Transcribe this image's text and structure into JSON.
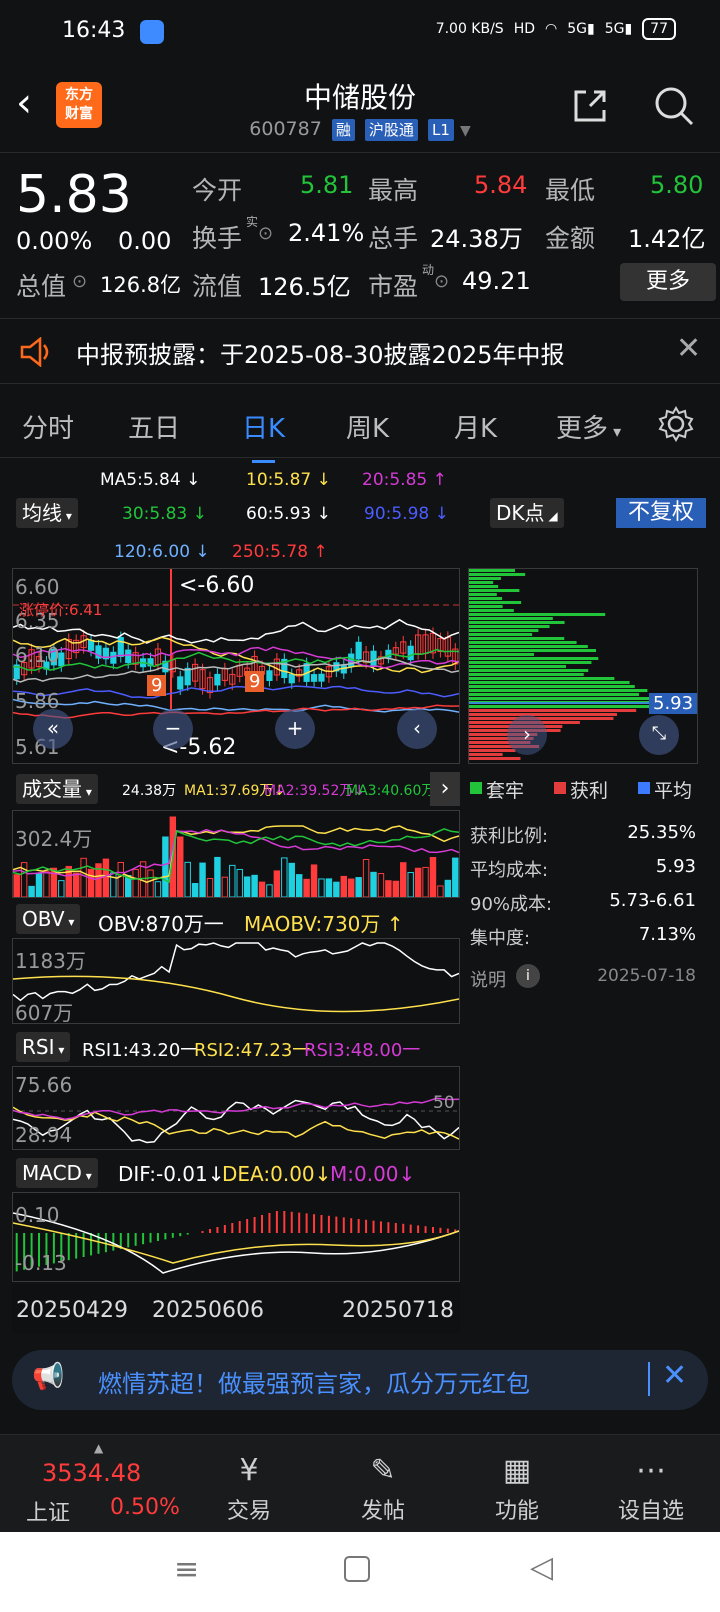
{
  "status": {
    "time": "16:43",
    "net_speed": "7.00 KB/S",
    "battery": "77"
  },
  "header": {
    "logo_line1": "东方",
    "logo_line2": "财富",
    "name": "中储股份",
    "code": "600787",
    "tags": [
      "融",
      "沪股通",
      "L1"
    ]
  },
  "quote": {
    "price": "5.83",
    "change_pct": "0.00%",
    "change": "0.00",
    "rows": [
      [
        {
          "label": "今开",
          "value": "5.81",
          "color": "green"
        },
        {
          "label": "最高",
          "value": "5.84",
          "color": "red"
        },
        {
          "label": "最低",
          "value": "5.80",
          "color": "green"
        }
      ],
      [
        {
          "label": "换手",
          "value": "2.41%",
          "color": "white",
          "sup": "实"
        },
        {
          "label": "总手",
          "value": "24.38万",
          "color": "white"
        },
        {
          "label": "金额",
          "value": "1.42亿",
          "color": "white"
        }
      ],
      [
        {
          "label": "总值",
          "value": "126.8亿",
          "color": "white"
        },
        {
          "label": "流值",
          "value": "126.5亿",
          "color": "white"
        },
        {
          "label": "市盈",
          "value": "49.21",
          "color": "white",
          "sup": "动"
        }
      ]
    ],
    "more_label": "更多"
  },
  "notice": {
    "text": "中报预披露：于2025-08-30披露2025年中报"
  },
  "tabs": [
    "分时",
    "五日",
    "日K",
    "周K",
    "月K",
    "更多"
  ],
  "active_tab": 2,
  "ma": {
    "ma5": "MA5:5.84 ↓",
    "ma10": "10:5.87 ↓",
    "ma20": "20:5.85 ↑",
    "ma30": "30:5.83 ↓",
    "ma60": "60:5.93 ↓",
    "ma90": "90:5.98 ↓",
    "ma120": "120:6.00 ↓",
    "ma250": "250:5.78 ↑",
    "btn_junxian": "均线",
    "btn_dk": "DK点",
    "btn_fq": "不复权"
  },
  "kline": {
    "y_top": "6.60",
    "y_mid1": "6.35",
    "y_mid2": "6.10",
    "y_mid3": "5.86",
    "y_bot": "5.61",
    "limit_label": "涨停价:6.41",
    "high_mark": "<-6.60",
    "low_mark": "<-5.62",
    "nine_label": "9"
  },
  "chips": {
    "price_label": "5.93",
    "legend": [
      "套牢",
      "获利",
      "平均"
    ],
    "stats": [
      {
        "label": "获利比例:",
        "value": "25.35%"
      },
      {
        "label": "平均成本:",
        "value": "5.93"
      },
      {
        "label": "90%成本:",
        "value": "5.73-6.61"
      },
      {
        "label": "集中度:",
        "value": "7.13%"
      }
    ],
    "explain": "说明",
    "date": "2025-07-18"
  },
  "volume": {
    "btn": "成交量",
    "vol": "24.38万",
    "ma1": "MA1:37.69万↓",
    "ma2": "MA2:39.52万↓",
    "ma3": "MA3:40.60万↓",
    "axis_top": "302.4万"
  },
  "obv": {
    "btn": "OBV",
    "obv": "OBV:870万一",
    "maobv": "MAOBV:730万 ↑",
    "axis_top": "1183万",
    "axis_bot": "607万"
  },
  "rsi": {
    "btn": "RSI",
    "rsi1": "RSI1:43.20一",
    "rsi2": "RSI2:47.23一",
    "rsi3": "RSI3:48.00一",
    "axis_top": "75.66",
    "axis_bot": "28.94",
    "mid": "50"
  },
  "macd": {
    "btn": "MACD",
    "dif": "DIF:-0.01↓",
    "dea": "DEA:0.00↓",
    "m": "M:0.00↓",
    "axis_top": "0.10",
    "axis_bot": "-0.13"
  },
  "dates": [
    "20250429",
    "20250606",
    "20250718"
  ],
  "banner": {
    "text": "燃情苏超！做最强预言家，瓜分万元红包"
  },
  "bottom_nav": {
    "index_value": "3534.48",
    "index_name": "上证",
    "index_change": "0.50%",
    "items": [
      "交易",
      "发帖",
      "功能",
      "设自选"
    ]
  }
}
